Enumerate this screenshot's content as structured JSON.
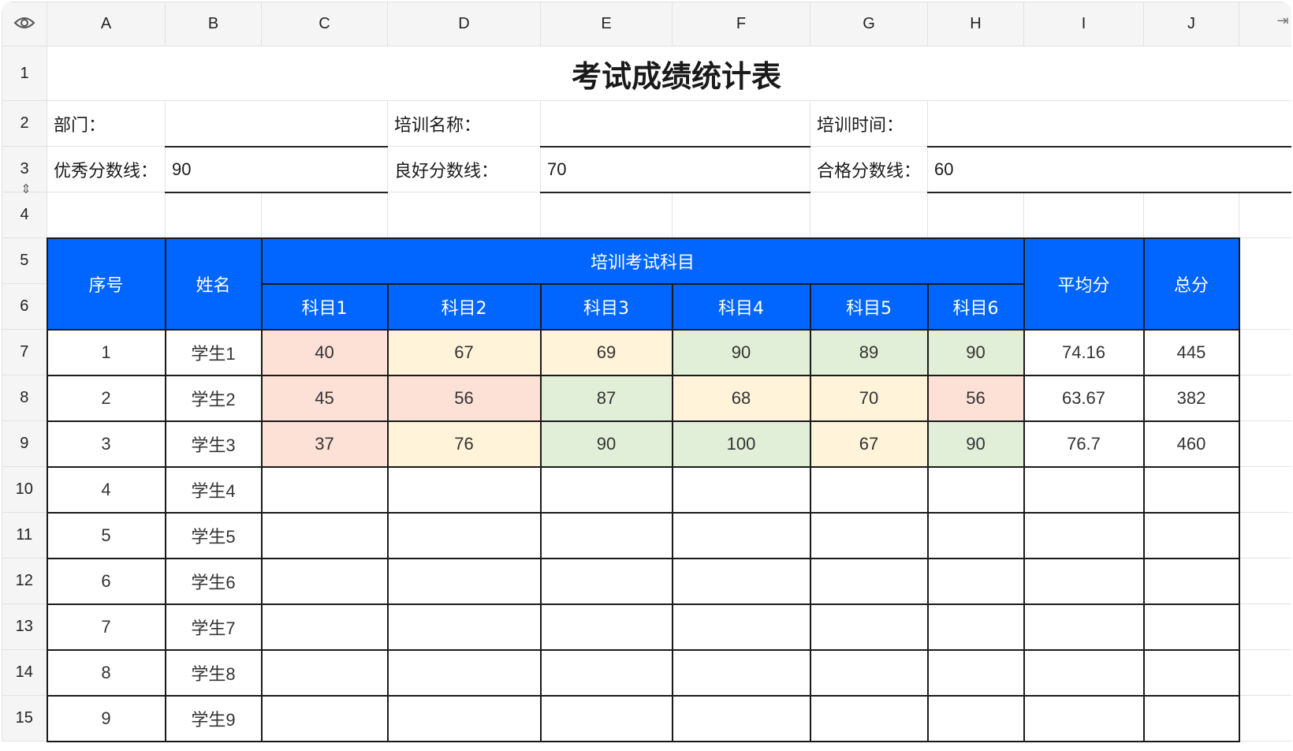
{
  "columns": [
    "A",
    "B",
    "C",
    "D",
    "E",
    "F",
    "G",
    "H",
    "I",
    "J"
  ],
  "rows": [
    "1",
    "2",
    "3",
    "4",
    "5",
    "6",
    "7",
    "8",
    "9",
    "10",
    "11",
    "12",
    "13",
    "14",
    "15"
  ],
  "sheet": {
    "title": "考试成绩统计表",
    "dept_label": "部门：",
    "training_name_label": "培训名称：",
    "training_time_label": "培训时间：",
    "excellent_label": "优秀分数线：",
    "excellent_value": "90",
    "good_label": "良好分数线：",
    "good_value": "70",
    "pass_label": "合格分数线：",
    "pass_value": "60"
  },
  "table": {
    "seq_header": "序号",
    "name_header": "姓名",
    "subjects_header": "培训考试科目",
    "avg_header": "平均分",
    "total_header": "总分",
    "subjects": [
      "科目1",
      "科目2",
      "科目3",
      "科目4",
      "科目5",
      "科目6"
    ],
    "students": [
      {
        "seq": "1",
        "name": "学生1",
        "scores": [
          "40",
          "67",
          "69",
          "90",
          "89",
          "90"
        ],
        "avg": "74.16",
        "total": "445"
      },
      {
        "seq": "2",
        "name": "学生2",
        "scores": [
          "45",
          "56",
          "87",
          "68",
          "70",
          "56"
        ],
        "avg": "63.67",
        "total": "382"
      },
      {
        "seq": "3",
        "name": "学生3",
        "scores": [
          "37",
          "76",
          "90",
          "100",
          "67",
          "90"
        ],
        "avg": "76.7",
        "total": "460"
      },
      {
        "seq": "4",
        "name": "学生4",
        "scores": [
          "",
          "",
          "",
          "",
          "",
          ""
        ],
        "avg": "",
        "total": ""
      },
      {
        "seq": "5",
        "name": "学生5",
        "scores": [
          "",
          "",
          "",
          "",
          "",
          ""
        ],
        "avg": "",
        "total": ""
      },
      {
        "seq": "6",
        "name": "学生6",
        "scores": [
          "",
          "",
          "",
          "",
          "",
          ""
        ],
        "avg": "",
        "total": ""
      },
      {
        "seq": "7",
        "name": "学生7",
        "scores": [
          "",
          "",
          "",
          "",
          "",
          ""
        ],
        "avg": "",
        "total": ""
      },
      {
        "seq": "8",
        "name": "学生8",
        "scores": [
          "",
          "",
          "",
          "",
          "",
          ""
        ],
        "avg": "",
        "total": ""
      },
      {
        "seq": "9",
        "name": "学生9",
        "scores": [
          "",
          "",
          "",
          "",
          "",
          ""
        ],
        "avg": "",
        "total": ""
      }
    ]
  },
  "colors": {
    "header_blue": "#0066ff",
    "below_pass": "#fde1d7",
    "pass_to_good": "#fff3d9",
    "good_and_above": "#e2efd8"
  },
  "icons": {
    "corner": "eye-icon",
    "row_resize": "row-resize-icon",
    "scroll": "scroll-right-icon"
  }
}
